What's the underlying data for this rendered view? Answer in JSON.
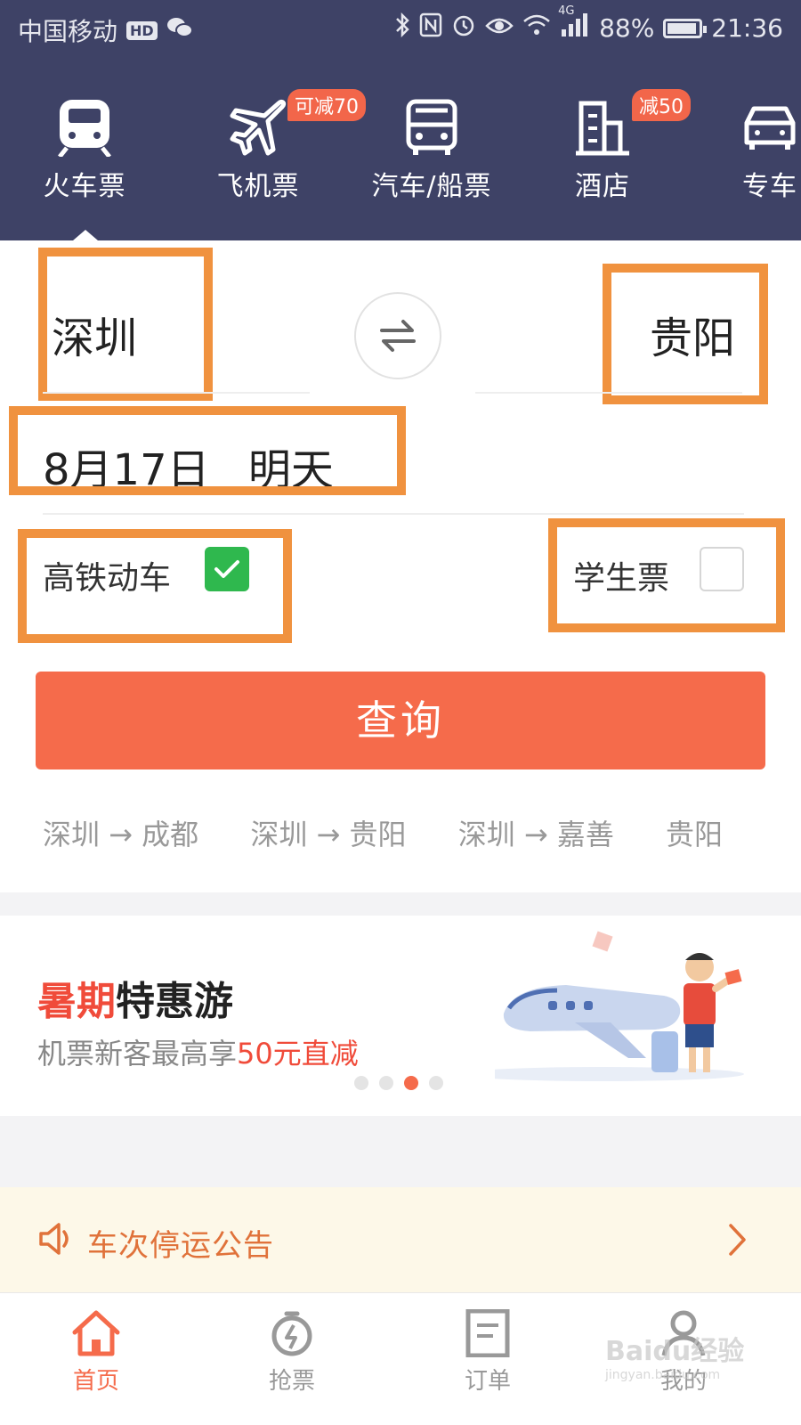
{
  "status_bar": {
    "carrier": "中国移动",
    "hd": "HD",
    "network": "4G",
    "battery": "88%",
    "time": "21:36"
  },
  "nav": [
    {
      "label": "火车票",
      "icon": "train-icon",
      "badge": ""
    },
    {
      "label": "飞机票",
      "icon": "plane-icon",
      "badge": "可减70"
    },
    {
      "label": "汽车/船票",
      "icon": "bus-icon",
      "badge": ""
    },
    {
      "label": "酒店",
      "icon": "hotel-icon",
      "badge": "减50"
    },
    {
      "label": "专车",
      "icon": "car-icon",
      "badge": ""
    }
  ],
  "form": {
    "from_city": "深圳",
    "to_city": "贵阳",
    "date": "8月17日",
    "date_relative": "明天",
    "option_highspeed": "高铁动车",
    "option_highspeed_checked": true,
    "option_student": "学生票",
    "option_student_checked": false,
    "search_label": "查询"
  },
  "recent_routes": [
    "深圳 → 成都",
    "深圳 → 贵阳",
    "深圳 → 嘉善",
    "贵阳"
  ],
  "banner": {
    "title_highlight": "暑期",
    "title_rest": "特惠游",
    "subtitle_prefix": "机票新客最高享",
    "subtitle_highlight": "50元直减",
    "active_dot": 3,
    "dot_count": 4
  },
  "notice": {
    "text": "车次停运公告"
  },
  "tabs": [
    {
      "label": "首页",
      "icon": "home-icon",
      "active": true
    },
    {
      "label": "抢票",
      "icon": "stopwatch-icon",
      "active": false
    },
    {
      "label": "订单",
      "icon": "order-icon",
      "active": false
    },
    {
      "label": "我的",
      "icon": "user-icon",
      "active": false
    }
  ],
  "watermark": {
    "brand": "Baidu经验",
    "url": "jingyan.baidu.com"
  },
  "colors": {
    "header_bg": "#3e4266",
    "accent": "#f56b4b",
    "highlight_box": "#f0923f",
    "checkbox_on": "#2fb84e",
    "notice_bg": "#fdf8e8"
  }
}
